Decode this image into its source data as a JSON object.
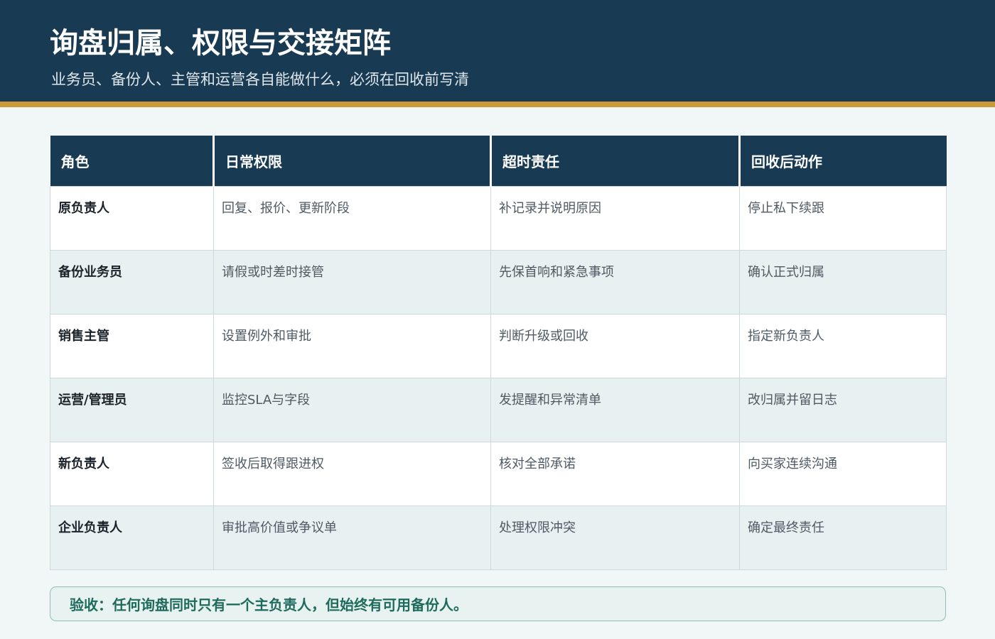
{
  "header": {
    "title": "询盘归属、权限与交接矩阵",
    "subtitle": "业务员、备份人、主管和运营各自能做什么，必须在回收前写清"
  },
  "table": {
    "headers": [
      "角色",
      "日常权限",
      "超时责任",
      "回收后动作"
    ],
    "rows": [
      [
        "原负责人",
        "回复、报价、更新阶段",
        "补记录并说明原因",
        "停止私下续跟"
      ],
      [
        "备份业务员",
        "请假或时差时接管",
        "先保首响和紧急事项",
        "确认正式归属"
      ],
      [
        "销售主管",
        "设置例外和审批",
        "判断升级或回收",
        "指定新负责人"
      ],
      [
        "运营/管理员",
        "监控SLA与字段",
        "发提醒和异常清单",
        "改归属并留日志"
      ],
      [
        "新负责人",
        "签收后取得跟进权",
        "核对全部承诺",
        "向买家连续沟通"
      ],
      [
        "企业负责人",
        "审批高价值或争议单",
        "处理权限冲突",
        "确定最终责任"
      ]
    ]
  },
  "footer": {
    "acceptance": "验收：任何询盘同时只有一个主负责人，但始终有可用备份人。"
  },
  "colors": {
    "header_bg": "#183a52",
    "accent_stripe": "#c99a3a",
    "notice_text": "#1e6b5e"
  }
}
